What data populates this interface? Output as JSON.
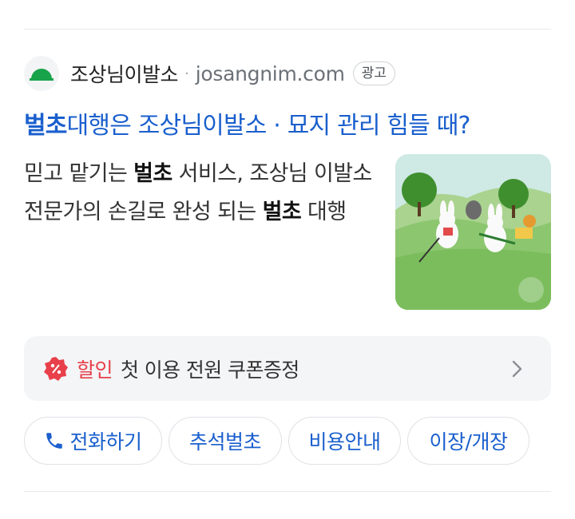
{
  "result": {
    "site_name": "조상님이발소",
    "separator": "·",
    "url": "josangnim.com",
    "ad_label": "광고",
    "title_bold": "벌초",
    "title_rest": "대행은 조상님이발소 · 묘지 관리 힘들 때?",
    "desc": {
      "part1": "믿고 맡기는 ",
      "bold1": "벌초",
      "part2": " 서비스, 조상님 이발소 전문가의 손길로 완성 되는 ",
      "bold2": "벌초",
      "part3": " 대행"
    }
  },
  "promo": {
    "label": "할인",
    "text": "첫 이용 전원 쿠폰증정",
    "icon": "discount-badge-icon"
  },
  "buttons": [
    {
      "label": "전화하기",
      "icon": "phone-icon"
    },
    {
      "label": "추석벌초"
    },
    {
      "label": "비용안내"
    },
    {
      "label": "이장/개장"
    }
  ],
  "colors": {
    "link_blue": "#1a5fcd",
    "discount_red": "#e8404a",
    "logo_green": "#17a34a"
  }
}
